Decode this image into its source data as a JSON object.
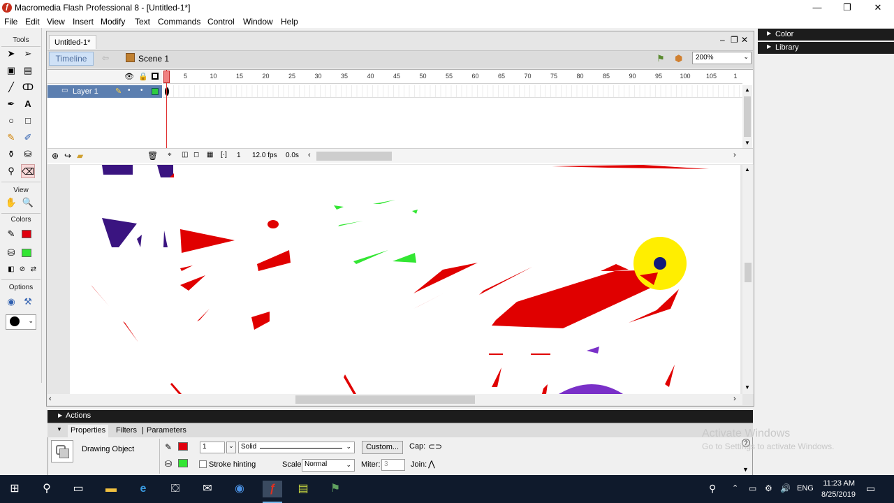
{
  "window": {
    "title": "Macromedia Flash Professional 8 - [Untitled-1*]",
    "minimize": "—",
    "restore": "❐",
    "close": "✕"
  },
  "menu": [
    "File",
    "Edit",
    "View",
    "Insert",
    "Modify",
    "Text",
    "Commands",
    "Control",
    "Window",
    "Help"
  ],
  "tools_panel": {
    "tools_label": "Tools",
    "view_label": "View",
    "colors_label": "Colors",
    "options_label": "Options",
    "stroke_color": "#e0000f",
    "fill_color": "#33e633"
  },
  "document": {
    "tab_title": "Untitled-1*",
    "timeline_button": "Timeline",
    "scene": "Scene 1",
    "zoom": "200%"
  },
  "timeline": {
    "layer_name": "Layer 1",
    "frame_numbers": [
      "5",
      "10",
      "15",
      "20",
      "25",
      "30",
      "35",
      "40",
      "45",
      "50",
      "55",
      "60",
      "65",
      "70",
      "75",
      "80",
      "85",
      "90",
      "95",
      "100",
      "105",
      "1"
    ],
    "current_frame": "1",
    "fps": "12.0 fps",
    "elapsed": "0.0s"
  },
  "right_panels": {
    "color": "Color",
    "library": "Library"
  },
  "bottom_panels": {
    "actions": "Actions",
    "tabs": [
      "Properties",
      "Filters",
      "Parameters"
    ],
    "object_type": "Drawing Object",
    "stroke_width": "1",
    "stroke_style": "Solid",
    "custom_button": "Custom...",
    "cap_label": "Cap:",
    "stroke_hinting": "Stroke hinting",
    "scale_label": "Scale:",
    "scale_value": "Normal",
    "miter_label": "Miter:",
    "miter_value": "3",
    "join_label": "Join:",
    "help_icon": "?"
  },
  "watermark": {
    "line1": "Activate Windows",
    "line2": "Go to Settings to activate Windows."
  },
  "taskbar": {
    "time": "11:23 AM",
    "date": "8/25/2019",
    "language": "ENG"
  }
}
